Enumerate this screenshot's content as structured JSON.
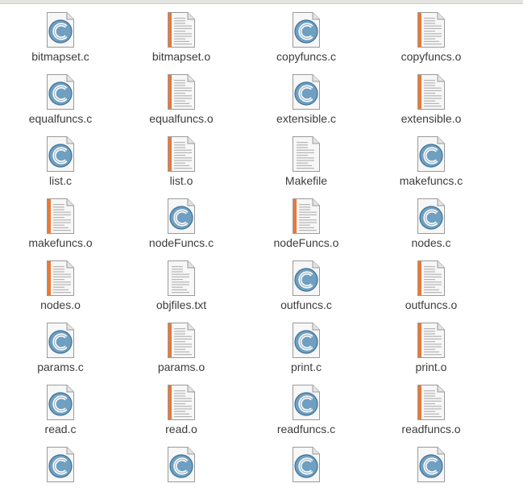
{
  "window": {
    "title": ""
  },
  "files": [
    {
      "name": "bitmapset.c",
      "type": "c-source"
    },
    {
      "name": "bitmapset.o",
      "type": "object"
    },
    {
      "name": "copyfuncs.c",
      "type": "c-source"
    },
    {
      "name": "copyfuncs.o",
      "type": "object"
    },
    {
      "name": "equalfuncs.c",
      "type": "c-source"
    },
    {
      "name": "equalfuncs.o",
      "type": "object"
    },
    {
      "name": "extensible.c",
      "type": "c-source"
    },
    {
      "name": "extensible.o",
      "type": "object"
    },
    {
      "name": "list.c",
      "type": "c-source"
    },
    {
      "name": "list.o",
      "type": "object"
    },
    {
      "name": "Makefile",
      "type": "text"
    },
    {
      "name": "makefuncs.c",
      "type": "c-source"
    },
    {
      "name": "makefuncs.o",
      "type": "object"
    },
    {
      "name": "nodeFuncs.c",
      "type": "c-source"
    },
    {
      "name": "nodeFuncs.o",
      "type": "object"
    },
    {
      "name": "nodes.c",
      "type": "c-source"
    },
    {
      "name": "nodes.o",
      "type": "object"
    },
    {
      "name": "objfiles.txt",
      "type": "text"
    },
    {
      "name": "outfuncs.c",
      "type": "c-source"
    },
    {
      "name": "outfuncs.o",
      "type": "object"
    },
    {
      "name": "params.c",
      "type": "c-source"
    },
    {
      "name": "params.o",
      "type": "object"
    },
    {
      "name": "print.c",
      "type": "c-source"
    },
    {
      "name": "print.o",
      "type": "object"
    },
    {
      "name": "read.c",
      "type": "c-source"
    },
    {
      "name": "read.o",
      "type": "object"
    },
    {
      "name": "readfuncs.c",
      "type": "c-source"
    },
    {
      "name": "readfuncs.o",
      "type": "object"
    },
    {
      "name": "",
      "type": "c-source"
    },
    {
      "name": "",
      "type": "c-source"
    },
    {
      "name": "",
      "type": "c-source"
    },
    {
      "name": "",
      "type": "c-source"
    }
  ],
  "colors": {
    "object_stripe": "#e8793a",
    "c_badge_outer": "#6f9fc1",
    "c_badge_inner": "#3f7298",
    "page": "#f7f7f7",
    "page_border": "#9a9a9a",
    "text": "#3c3c3c"
  },
  "icons": {
    "c-source": "c-source-file-icon",
    "object": "object-file-icon",
    "text": "text-file-icon"
  }
}
